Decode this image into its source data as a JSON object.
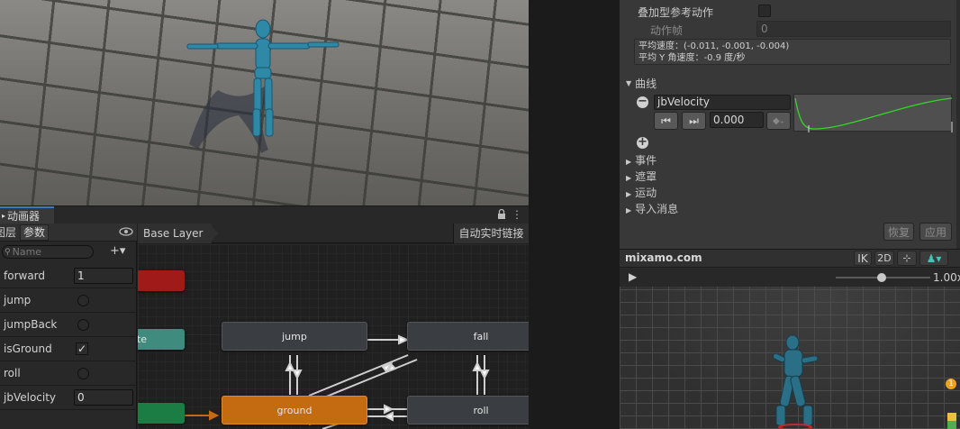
{
  "animator": {
    "window_title": "动画器",
    "lock_icon": "lock-icon",
    "menu_icon": "kebab-menu-icon",
    "tabs": {
      "layers": "图层",
      "params": "参数"
    },
    "search_placeholder": "Name",
    "add_label": "+▾",
    "breadcrumb": "Base Layer",
    "auto_live_link": "自动实时链接",
    "parameters": [
      {
        "name": "forward",
        "type": "float",
        "value": "1"
      },
      {
        "name": "jump",
        "type": "trigger"
      },
      {
        "name": "jumpBack",
        "type": "trigger"
      },
      {
        "name": "isGround",
        "type": "bool",
        "checked": true,
        "mark": "✓"
      },
      {
        "name": "roll",
        "type": "trigger"
      },
      {
        "name": "jbVelocity",
        "type": "float",
        "value": "0"
      }
    ],
    "states": {
      "jump": "jump",
      "fall": "fall",
      "ground": "ground",
      "roll": "roll",
      "partial_te": "te"
    },
    "colors": {
      "entry_green": "#1b7d43",
      "any_teal": "#3f8c7e",
      "exit_red": "#a11a1a",
      "default_orange": "#c46a11",
      "state_gray": "#3a3d41"
    }
  },
  "inspector": {
    "additive_ref_pose": "叠加型参考动作",
    "ref_frame_label": "动作帧",
    "ref_frame_value": "0",
    "avg_velocity": "平均速度：(-0.011, -0.001, -0.004)",
    "avg_y_angular": "平均 Y 角速度：-0.9 度/秒",
    "curves_label": "曲线",
    "curve_name": "jbVelocity",
    "curve_value": "0.000",
    "sections": [
      "事件",
      "遮罩",
      "运动",
      "导入消息"
    ],
    "revert": "恢复",
    "apply": "应用",
    "curve_color": "#34d62a"
  },
  "preview": {
    "title": "mixamo.com",
    "ik": "IK",
    "mode_2d": "2D",
    "speed": "1.00x",
    "play_icon": "play-icon",
    "badge": "1"
  }
}
